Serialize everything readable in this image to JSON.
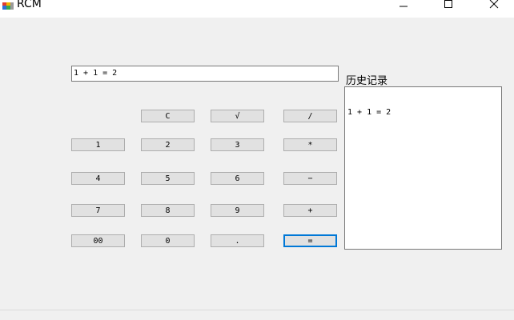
{
  "window": {
    "title": "RCM",
    "icon": "app-icon",
    "controls": [
      "minimize-icon",
      "maximize-icon",
      "close-icon"
    ]
  },
  "display": {
    "value": "1 + 1 = 2"
  },
  "history": {
    "label": "历史记录",
    "entries": [
      "1 + 1 = 2"
    ]
  },
  "keys": {
    "clear": "C",
    "sqrt": "√",
    "divide": "/",
    "multiply": "*",
    "minus": "−",
    "plus": "+",
    "equals": "=",
    "dot": ".",
    "d0": "0",
    "d00": "00",
    "d1": "1",
    "d2": "2",
    "d3": "3",
    "d4": "4",
    "d5": "5",
    "d6": "6",
    "d7": "7",
    "d8": "8",
    "d9": "9"
  },
  "colors": {
    "accent": "#0078d7"
  }
}
